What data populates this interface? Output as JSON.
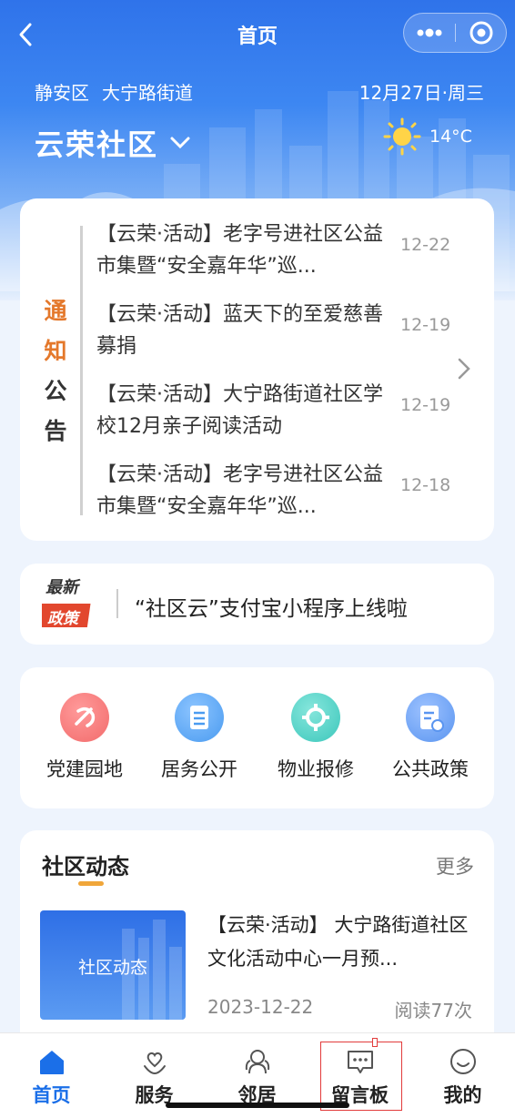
{
  "nav": {
    "title": "首页"
  },
  "location": {
    "district": "静安区",
    "street": "大宁路街道",
    "date": "12月27日·周三"
  },
  "community": {
    "name": "云荣社区"
  },
  "weather": {
    "temp": "14°C",
    "icon": "sun-icon"
  },
  "notice": {
    "tag": [
      "通",
      "知",
      "公",
      "告"
    ],
    "items": [
      {
        "title": "【云荣·活动】老字号进社区公益市集暨“安全嘉年华”巡...",
        "date": "12-22"
      },
      {
        "title": "【云荣·活动】蓝天下的至爱慈善募捐",
        "date": "12-19"
      },
      {
        "title": "【云荣·活动】大宁路街道社区学校12月亲子阅读活动",
        "date": "12-19"
      },
      {
        "title": "【云荣·活动】老字号进社区公益市集暨“安全嘉年华”巡...",
        "date": "12-18"
      }
    ]
  },
  "policy": {
    "badge_top": "最新",
    "badge_bottom": "政策",
    "text": "“社区云”支付宝小程序上线啦"
  },
  "services": [
    {
      "label": "党建园地",
      "icon": "party-emblem-icon",
      "color": "#f26b6b"
    },
    {
      "label": "居务公开",
      "icon": "document-icon",
      "color": "#4a9bf0"
    },
    {
      "label": "物业报修",
      "icon": "repair-gear-icon",
      "color": "#3cc7bb"
    },
    {
      "label": "公共政策",
      "icon": "policy-doc-icon",
      "color": "#5a95f0"
    }
  ],
  "news": {
    "heading": "社区动态",
    "more": "更多",
    "thumb_label": "社区动态",
    "item": {
      "title": "【云荣·活动】 大宁路街道社区文化活动中心一月预...",
      "date": "2023-12-22",
      "reads": "阅读77次"
    }
  },
  "tabbar": [
    {
      "label": "首页",
      "icon": "home-icon",
      "active": true
    },
    {
      "label": "服务",
      "icon": "heart-hand-icon",
      "active": false
    },
    {
      "label": "邻居",
      "icon": "neighbors-icon",
      "active": false
    },
    {
      "label": "留言板",
      "icon": "message-board-icon",
      "active": false
    },
    {
      "label": "我的",
      "icon": "smiley-icon",
      "active": false
    }
  ]
}
